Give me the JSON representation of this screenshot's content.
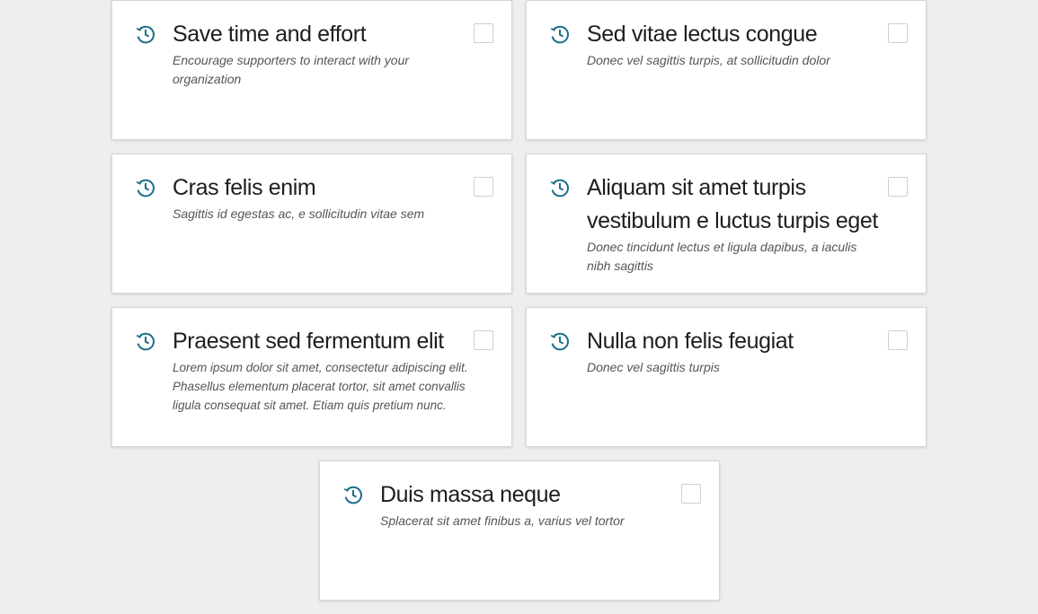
{
  "colors": {
    "background": "#eeeeee",
    "card": "#ffffff",
    "icon": "#1a6f8c",
    "title": "#1e1e1e",
    "description": "#555555"
  },
  "icon": "clock-history-icon",
  "cards": [
    {
      "title": "Save time and effort",
      "description": "Encourage supporters to interact with your organization",
      "checked": false
    },
    {
      "title": "Sed vitae lectus congue",
      "description": "Donec vel sagittis turpis, at sollicitudin dolor",
      "checked": false
    },
    {
      "title": "Cras felis enim",
      "description": "Sagittis id egestas ac, e sollicitudin vitae sem",
      "checked": false
    },
    {
      "title": "Aliquam sit amet turpis vestibulum e luctus turpis eget",
      "description": "Donec tincidunt lectus et ligula dapibus, a iaculis nibh sagittis",
      "checked": false
    },
    {
      "title": "Praesent sed fermentum elit",
      "description": "Lorem ipsum dolor sit amet, consectetur adipiscing elit. Phasellus elementum placerat tortor, sit amet convallis ligula consequat sit amet. Etiam quis pretium nunc.",
      "checked": false
    },
    {
      "title": "Nulla non felis feugiat",
      "description": "Donec vel sagittis turpis",
      "checked": false
    },
    {
      "title": "Duis massa neque",
      "description": "Splacerat sit amet finibus a, varius vel tortor",
      "checked": false
    }
  ]
}
